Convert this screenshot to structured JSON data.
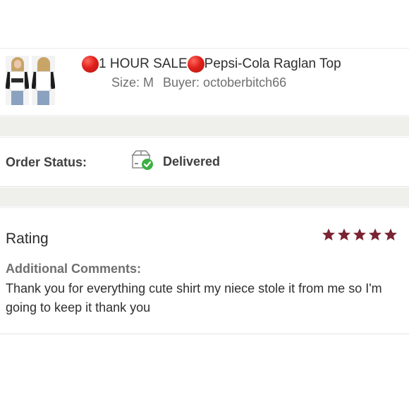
{
  "listing": {
    "sale_prefix": "1 HOUR SALE",
    "title": "Pepsi-Cola Raglan Top",
    "size": "Size: M",
    "buyer": "Buyer: octoberbitch66",
    "dot_color": "#e0211c",
    "thumbnails": [
      "product-front-photo",
      "product-back-photo"
    ]
  },
  "order": {
    "status_label": "Order Status:",
    "status_value": "Delivered",
    "status_icon": "package-delivered-icon",
    "check_color": "#3cb043"
  },
  "rating": {
    "label": "Rating",
    "stars": 5,
    "max_stars": 5,
    "star_color": "#7a2431",
    "comments_label": "Additional Comments:",
    "comments_text": "Thank you for everything cute shirt my niece stole it from me so I'm going to keep it thank you"
  }
}
